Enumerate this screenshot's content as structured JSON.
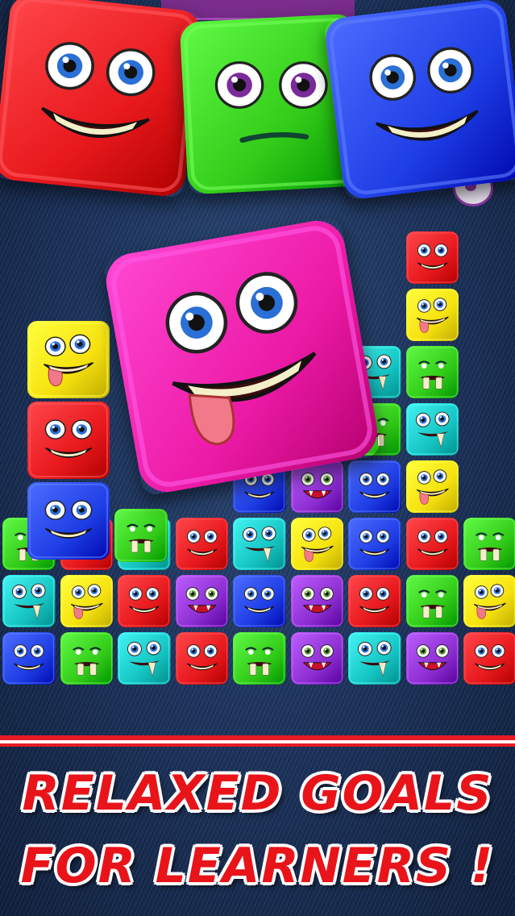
{
  "promo": {
    "line1": "RELAXED GOALS",
    "line2": "FOR LEARNERS !"
  },
  "colors": {
    "red": "#e8191d",
    "green": "#33cc19",
    "blue": "#1f3fe6",
    "yellow": "#f6e20f",
    "pink": "#ec1aa6",
    "teal": "#16c6c4",
    "purple": "#8e2fd3",
    "slogan": "#e8141a",
    "floor_red": "#e51b25",
    "floor_white": "#ffffff"
  },
  "monster_types": {
    "red": "smiling-eyes",
    "green": "buck-teeth",
    "blue": "smiling-eyes",
    "yellow": "tongue-out",
    "pink": "tongue-out",
    "teal": "one-eye-fangs",
    "purple": "fangs-grin"
  },
  "featured_blocks": [
    {
      "color": "red",
      "face": "grin"
    },
    {
      "color": "green",
      "face": "neutral"
    },
    {
      "color": "blue",
      "face": "grin"
    },
    {
      "color": "pink",
      "face": "tongue"
    }
  ],
  "board": {
    "rows": [
      [
        "",
        "",
        "",
        "",
        "",
        "",
        "",
        "red",
        ""
      ],
      [
        "",
        "",
        "",
        "",
        "",
        "",
        "",
        "yellow",
        ""
      ],
      [
        "",
        "",
        "",
        "",
        "",
        "",
        "teal",
        "green",
        ""
      ],
      [
        "",
        "",
        "",
        "",
        "",
        "teal",
        "green",
        "teal",
        ""
      ],
      [
        "",
        "",
        "",
        "",
        "blue",
        "purple",
        "blue",
        "yellow",
        ""
      ],
      [
        "green",
        "red",
        "teal",
        "red",
        "teal",
        "yellow",
        "blue",
        "red",
        "green"
      ],
      [
        "teal",
        "yellow",
        "red",
        "purple",
        "blue",
        "purple",
        "red",
        "green",
        "yellow"
      ],
      [
        "blue",
        "green",
        "teal",
        "red",
        "green",
        "purple",
        "teal",
        "purple",
        "red"
      ]
    ],
    "left_stack": [
      "yellow",
      "red",
      "blue"
    ],
    "left_stack_neighbor": "green"
  }
}
